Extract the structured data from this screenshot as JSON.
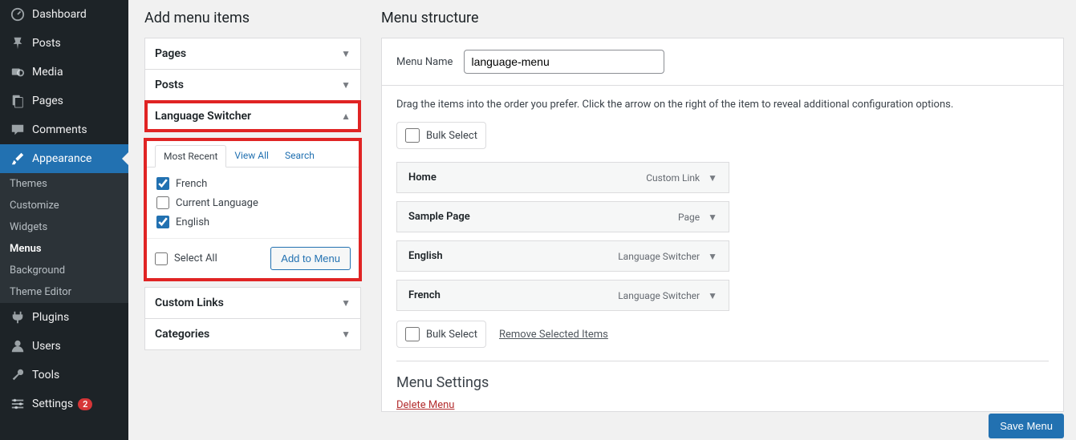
{
  "sidebar": {
    "dashboard": "Dashboard",
    "posts": "Posts",
    "media": "Media",
    "pages": "Pages",
    "comments": "Comments",
    "appearance": "Appearance",
    "sub_themes": "Themes",
    "sub_customize": "Customize",
    "sub_widgets": "Widgets",
    "sub_menus": "Menus",
    "sub_background": "Background",
    "sub_theme_editor": "Theme Editor",
    "plugins": "Plugins",
    "users": "Users",
    "tools": "Tools",
    "settings": "Settings",
    "settings_badge": "2"
  },
  "add_panel": {
    "title": "Add menu items",
    "pages": "Pages",
    "posts": "Posts",
    "language_switcher": "Language Switcher",
    "tabs": {
      "most_recent": "Most Recent",
      "view_all": "View All",
      "search": "Search"
    },
    "opts": {
      "french": "French",
      "current_language": "Current Language",
      "english": "English"
    },
    "select_all": "Select All",
    "add_to_menu": "Add to Menu",
    "custom_links": "Custom Links",
    "categories": "Categories"
  },
  "structure": {
    "title": "Menu structure",
    "menu_name_label": "Menu Name",
    "menu_name_value": "language-menu",
    "help": "Drag the items into the order you prefer. Click the arrow on the right of the item to reveal additional configuration options.",
    "bulk_select": "Bulk Select",
    "items": [
      {
        "title": "Home",
        "type": "Custom Link"
      },
      {
        "title": "Sample Page",
        "type": "Page"
      },
      {
        "title": "English",
        "type": "Language Switcher"
      },
      {
        "title": "French",
        "type": "Language Switcher"
      }
    ],
    "remove_selected": "Remove Selected Items",
    "menu_settings": "Menu Settings",
    "delete_menu": "Delete Menu",
    "save_menu": "Save Menu"
  }
}
